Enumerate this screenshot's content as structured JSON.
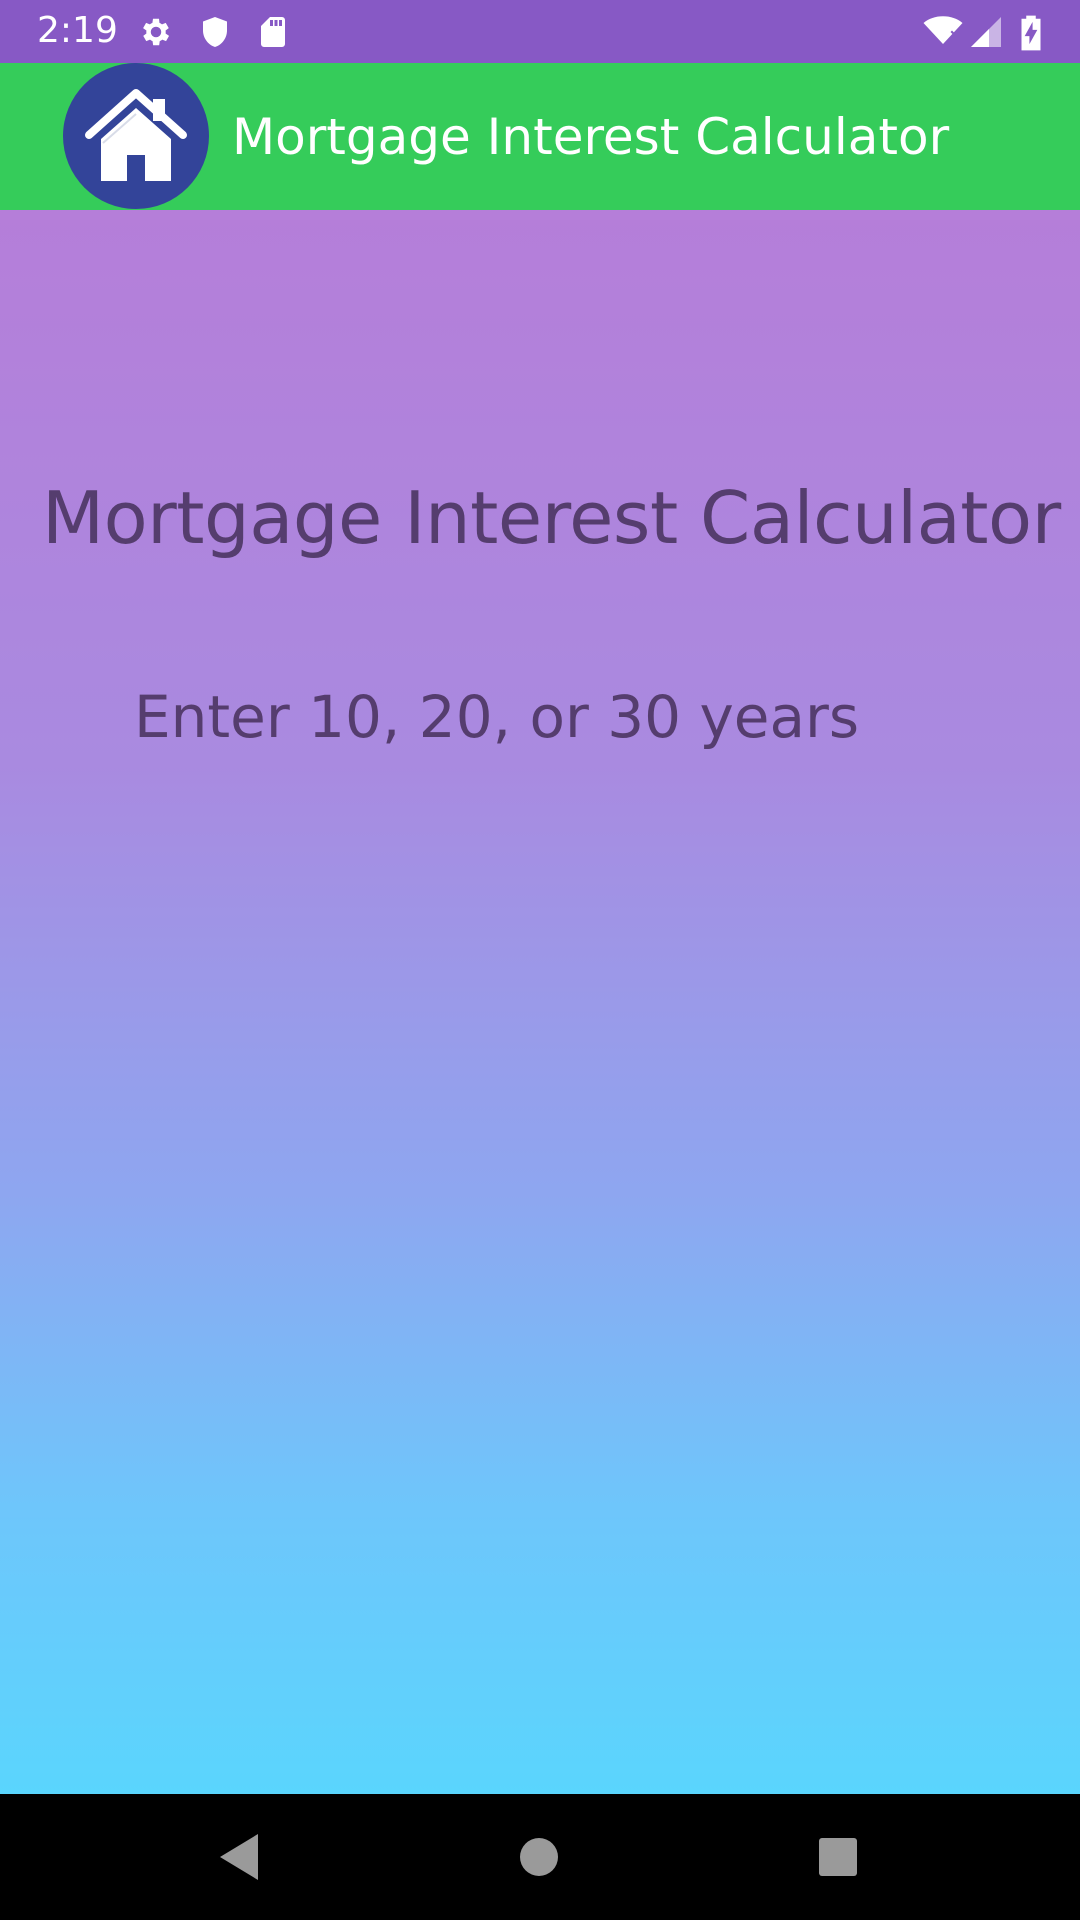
{
  "status_bar": {
    "time": "2:19",
    "left_icons": [
      "gear-icon",
      "shield-icon",
      "sd-card-icon"
    ],
    "right_icons": [
      "wifi-icon",
      "signal-icon",
      "battery-charging-icon"
    ],
    "background": "#8759c5"
  },
  "app_bar": {
    "title": "Mortgage Interest Calculator",
    "logo_icon": "home-icon",
    "background": "#35cc5a",
    "logo_background": "#334499"
  },
  "main": {
    "title": "Mortgage Interest Calculator",
    "instruction": "Enter 10, 20, or 30 years",
    "text_color": "#553d6e",
    "gradient_top": "#b57ed9",
    "gradient_bottom": "#5ad5fd"
  },
  "nav_bar": {
    "buttons": [
      "back-icon",
      "home-circle-icon",
      "recents-icon"
    ]
  }
}
